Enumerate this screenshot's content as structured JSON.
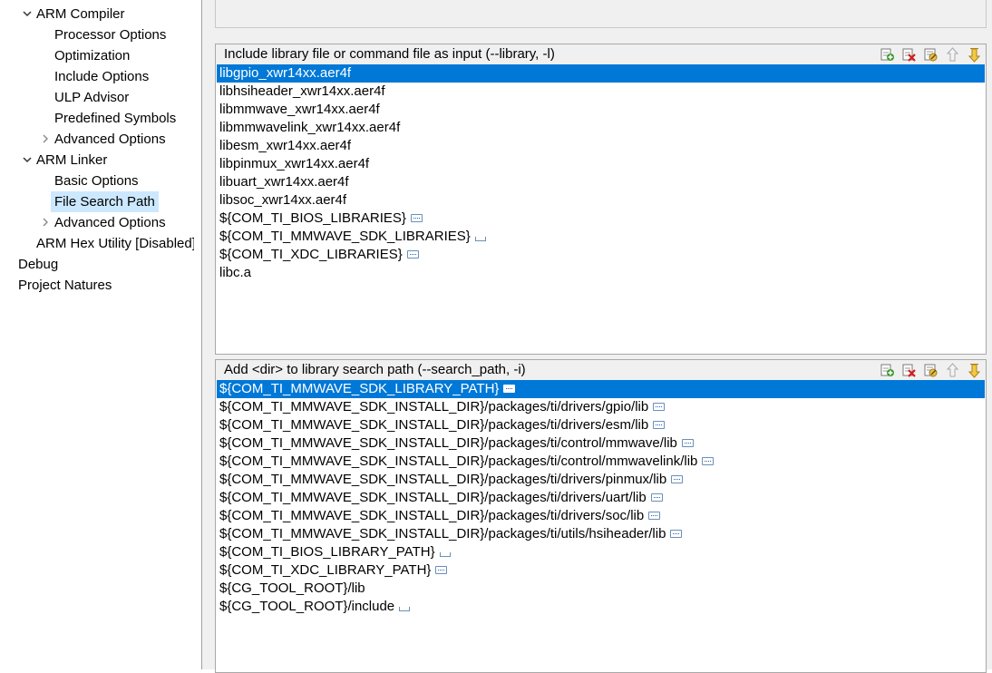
{
  "tree": {
    "items": [
      {
        "label": "ARM Compiler",
        "expand": "down"
      },
      {
        "label": "Processor Options"
      },
      {
        "label": "Optimization"
      },
      {
        "label": "Include Options"
      },
      {
        "label": "ULP Advisor"
      },
      {
        "label": "Predefined Symbols"
      },
      {
        "label": "Advanced Options",
        "expand": "right"
      },
      {
        "label": "ARM Linker",
        "expand": "down"
      },
      {
        "label": "Basic Options"
      },
      {
        "label": "File Search Path",
        "selected": true
      },
      {
        "label": "Advanced Options",
        "expand": "right"
      },
      {
        "label": "ARM Hex Utility  [Disabled]"
      },
      {
        "label": "Debug"
      },
      {
        "label": "Project Natures"
      }
    ]
  },
  "library_group": {
    "title": "Include library file or command file as input (--library, -l)",
    "items": [
      {
        "text": "libgpio_xwr14xx.aer4f",
        "selected": true
      },
      {
        "text": "libhsiheader_xwr14xx.aer4f"
      },
      {
        "text": "libmmwave_xwr14xx.aer4f"
      },
      {
        "text": "libmmwavelink_xwr14xx.aer4f"
      },
      {
        "text": "libesm_xwr14xx.aer4f"
      },
      {
        "text": "libpinmux_xwr14xx.aer4f"
      },
      {
        "text": "libuart_xwr14xx.aer4f"
      },
      {
        "text": "libsoc_xwr14xx.aer4f"
      },
      {
        "text": "${COM_TI_BIOS_LIBRARIES}",
        "marker": "ellipsis"
      },
      {
        "text": "${COM_TI_MMWAVE_SDK_LIBRARIES}",
        "marker": "space"
      },
      {
        "text": "${COM_TI_XDC_LIBRARIES}",
        "marker": "ellipsis"
      },
      {
        "text": "libc.a"
      }
    ]
  },
  "search_path_group": {
    "title": "Add <dir> to library search path (--search_path, -i)",
    "items": [
      {
        "text": "${COM_TI_MMWAVE_SDK_LIBRARY_PATH}",
        "selected": true,
        "marker": "ellipsis"
      },
      {
        "text": "${COM_TI_MMWAVE_SDK_INSTALL_DIR}/packages/ti/drivers/gpio/lib",
        "marker": "ellipsis"
      },
      {
        "text": "${COM_TI_MMWAVE_SDK_INSTALL_DIR}/packages/ti/drivers/esm/lib",
        "marker": "ellipsis"
      },
      {
        "text": "${COM_TI_MMWAVE_SDK_INSTALL_DIR}/packages/ti/control/mmwave/lib",
        "marker": "ellipsis"
      },
      {
        "text": "${COM_TI_MMWAVE_SDK_INSTALL_DIR}/packages/ti/control/mmwavelink/lib",
        "marker": "ellipsis"
      },
      {
        "text": "${COM_TI_MMWAVE_SDK_INSTALL_DIR}/packages/ti/drivers/pinmux/lib",
        "marker": "ellipsis"
      },
      {
        "text": "${COM_TI_MMWAVE_SDK_INSTALL_DIR}/packages/ti/drivers/uart/lib",
        "marker": "ellipsis"
      },
      {
        "text": "${COM_TI_MMWAVE_SDK_INSTALL_DIR}/packages/ti/drivers/soc/lib",
        "marker": "ellipsis"
      },
      {
        "text": "${COM_TI_MMWAVE_SDK_INSTALL_DIR}/packages/ti/utils/hsiheader/lib",
        "marker": "ellipsis"
      },
      {
        "text": "${COM_TI_BIOS_LIBRARY_PATH}",
        "marker": "space"
      },
      {
        "text": "${COM_TI_XDC_LIBRARY_PATH}",
        "marker": "ellipsis"
      },
      {
        "text": "${CG_TOOL_ROOT}/lib"
      },
      {
        "text": "${CG_TOOL_ROOT}/include",
        "marker": "space"
      }
    ]
  },
  "toolbar_icons": [
    "add-icon",
    "delete-icon",
    "edit-icon",
    "move-up-icon",
    "move-down-icon"
  ],
  "colors": {
    "selection": "#0078d7",
    "tree_selection": "#cce8ff"
  }
}
